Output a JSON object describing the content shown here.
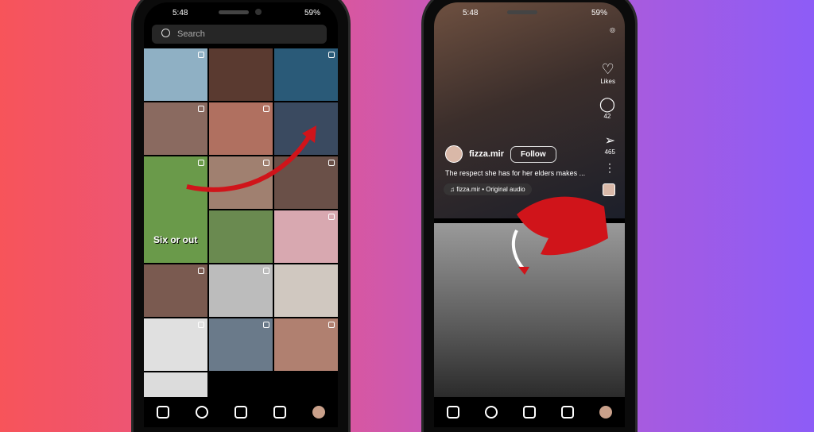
{
  "left_phone": {
    "status": {
      "time": "5:48",
      "battery": "59%"
    },
    "search": {
      "placeholder": "Search"
    },
    "tiles": [
      {
        "color": "#8fb0c4"
      },
      {
        "color": "#5a3a30"
      },
      {
        "color": "#2a5a78"
      },
      {
        "color": "#8a6a60"
      },
      {
        "color": "#b07060"
      },
      {
        "color": "#3a4a60"
      },
      {
        "color": "#6a9a4a",
        "caption": "Six or out"
      },
      {
        "color": "#a08070"
      },
      {
        "color": "#6a5048"
      },
      {
        "color": "#6a8a50"
      },
      {
        "color": "#d8a8b0"
      },
      {
        "color": "#7a5a50"
      },
      {
        "color": "#bcbcbc"
      },
      {
        "color": "#d0c8c0"
      },
      {
        "color": "#e0e0e0"
      },
      {
        "color": "#6a7a8a"
      },
      {
        "color": "#b08070"
      },
      {
        "color": "#dcdcdc"
      }
    ],
    "nav": [
      "home-icon",
      "search-icon",
      "create-icon",
      "reels-icon",
      "profile-avatar"
    ]
  },
  "right_phone": {
    "status": {
      "time": "5:48",
      "battery": "59%"
    },
    "reel": {
      "username": "fizza.mir",
      "follow_label": "Follow",
      "caption": "The respect she has for her elders makes ...",
      "audio": "fizza.mir • Original audio",
      "likes_label": "Likes",
      "comments": "42",
      "shares": "465"
    },
    "nav": [
      "home-icon",
      "search-icon",
      "create-icon",
      "reels-icon",
      "profile-avatar"
    ]
  },
  "colors": {
    "arrow": "#d0141a"
  }
}
